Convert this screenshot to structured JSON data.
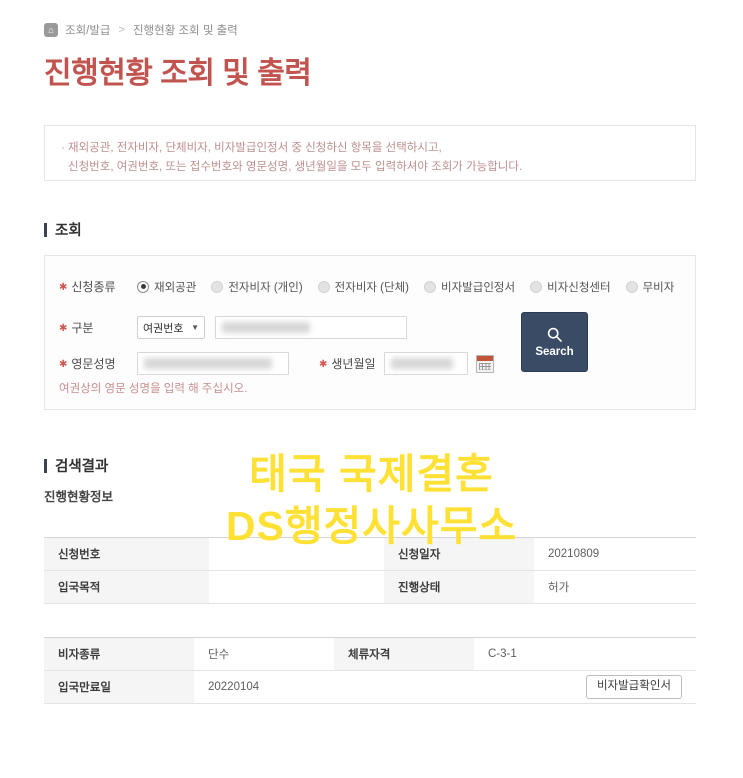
{
  "breadcrumb": {
    "home_icon": "home-icon",
    "items": [
      "조회/발급",
      "진행현황 조회 및 출력"
    ],
    "separator": ">"
  },
  "page_title": "진행현황 조회 및 출력",
  "notice": {
    "line1": "재외공관, 전자비자, 단체비자, 비자발급인정서 중 신청하신 항목을 선택하시고,",
    "line2": "신청번호, 여권번호, 또는 접수번호와 영문성명, 생년월일을 모두 입력하셔야 조회가 가능합니다."
  },
  "search_section": {
    "heading": "조회",
    "application_type": {
      "label": "신청종류",
      "options": [
        {
          "label": "재외공관",
          "selected": true
        },
        {
          "label": "전자비자 (개인)",
          "selected": false
        },
        {
          "label": "전자비자 (단체)",
          "selected": false
        },
        {
          "label": "비자발급인정서",
          "selected": false
        },
        {
          "label": "비자신청센터",
          "selected": false
        },
        {
          "label": "무비자",
          "selected": false
        }
      ]
    },
    "gubun": {
      "label": "구분",
      "select_value": "여권번호",
      "caret": "▼",
      "input_value": ""
    },
    "english_name": {
      "label": "영문성명",
      "input_value": ""
    },
    "birth_date": {
      "label": "생년월일",
      "input_value": "",
      "calendar_icon": "calendar-icon"
    },
    "helper_text": "여권상의 영문 성명을 입력 해 주십시오.",
    "search_button": {
      "label": "Search",
      "icon": "search-icon"
    },
    "required_mark": "✱"
  },
  "result_section": {
    "heading": "검색결과",
    "subtitle": "진행현황정보",
    "status_table": {
      "rows": [
        {
          "label1": "신청번호",
          "value1": "",
          "label2": "신청일자",
          "value2": "20210809"
        },
        {
          "label1": "입국목적",
          "value1": "",
          "label2": "진행상태",
          "value2": "허가"
        }
      ]
    },
    "visa_table": {
      "rows": [
        {
          "label1": "비자종류",
          "value1": "단수",
          "label2": "체류자격",
          "value2": "C-3-1"
        }
      ],
      "expiry_label": "입국만료일",
      "expiry_value": "20220104",
      "confirm_button": "비자발급확인서"
    }
  },
  "watermark": {
    "line1": "태국 국제결혼",
    "line2": "DS행정사사무소",
    "color": "#ffe135"
  },
  "colors": {
    "title": "#c2544f",
    "button": "#3a4b66",
    "accent_bar": "#3b4250"
  }
}
